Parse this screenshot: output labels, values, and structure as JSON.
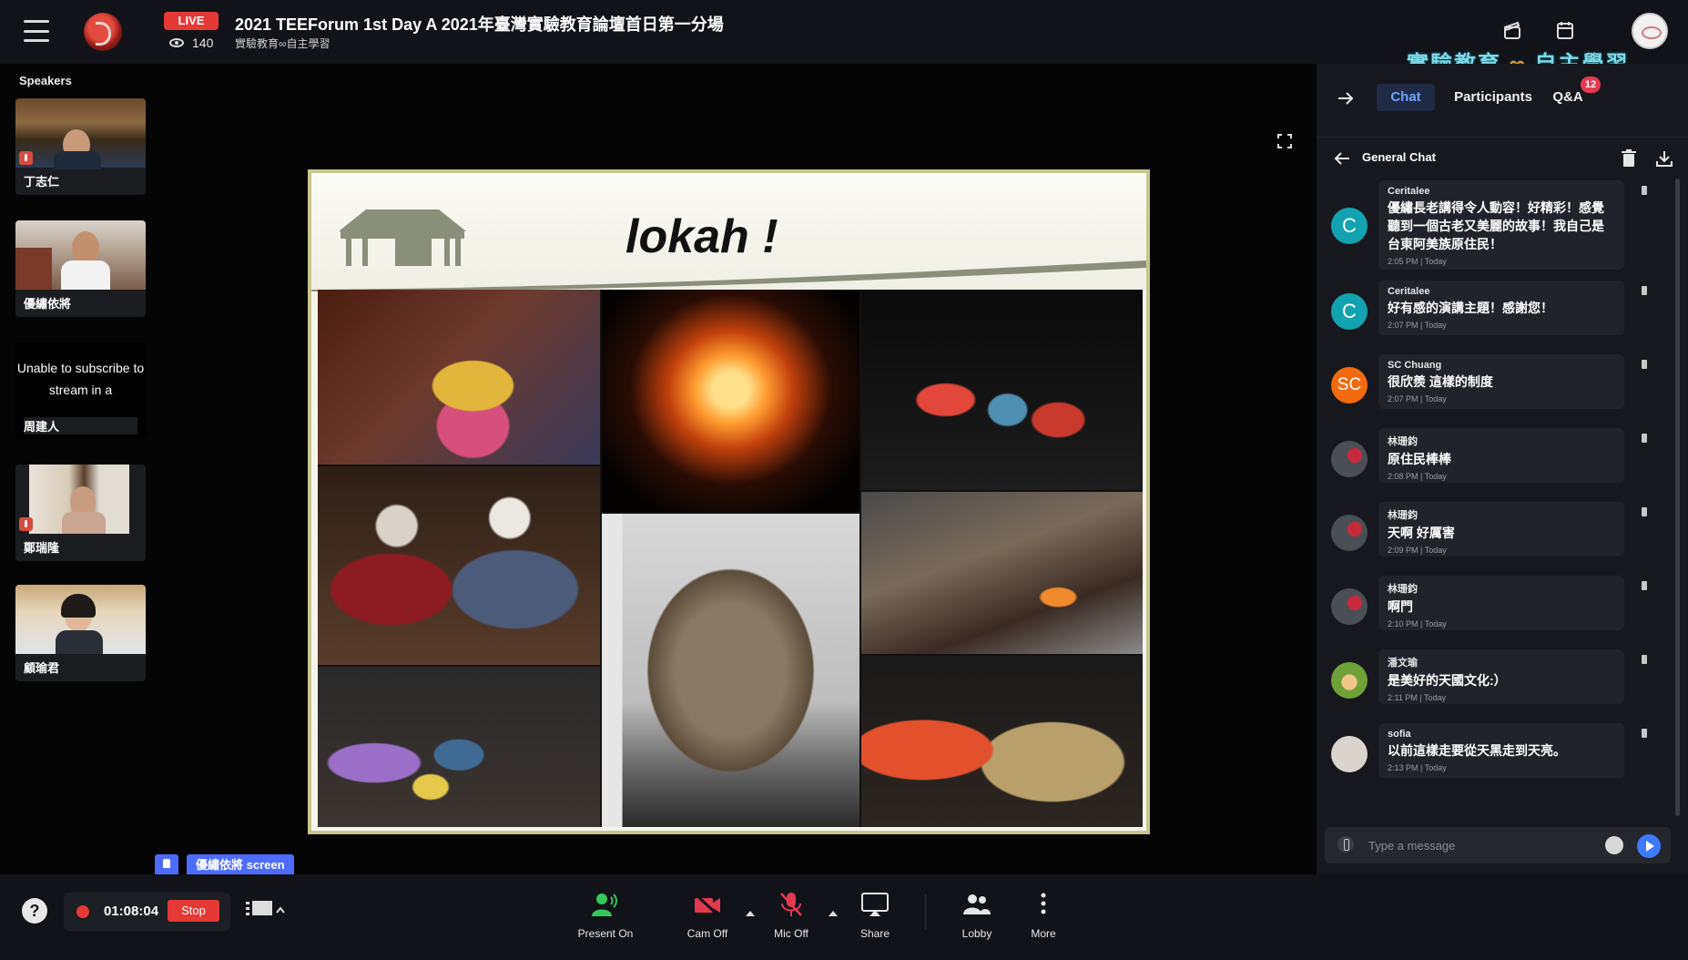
{
  "header": {
    "live_label": "LIVE",
    "viewer_count": "140",
    "title": "2021 TEEForum 1st Day A 2021年臺灣實驗教育論壇首日第一分場",
    "subtitle": "實驗教育∞自主學習",
    "watermark_left": "實驗教育",
    "watermark_infinity": "∞",
    "watermark_right": "自主學習"
  },
  "speakers": {
    "title": "Speakers",
    "tiles": [
      {
        "name": "丁志仁",
        "muted": true
      },
      {
        "name": "優繡依將",
        "muted": false
      },
      {
        "name": "周建人",
        "muted": false,
        "status": "Unable to subscribe to stream in a"
      },
      {
        "name": "鄭瑞隆",
        "muted": true
      },
      {
        "name": "顧瑜君",
        "muted": false
      }
    ]
  },
  "slide": {
    "title": "lokah !"
  },
  "chat": {
    "tabs": [
      "Chat",
      "Participants",
      "Q&A"
    ],
    "qa_badge": "12",
    "channel": "General Chat",
    "input_placeholder": "Type a message",
    "messages": [
      {
        "author": "Ceritalee",
        "initial": "C",
        "avatar_color": "#13a3b0",
        "text": "優繡長老講得令人動容！好精彩！感覺聽到一個古老又美麗的故事！我自己是台東阿美族原住民！",
        "time": "2:05 PM | Today"
      },
      {
        "author": "Ceritalee",
        "initial": "C",
        "avatar_color": "#13a3b0",
        "text": "好有感的演講主題！感謝您！",
        "time": "2:07 PM | Today"
      },
      {
        "author": "SC Chuang",
        "initial": "SC",
        "avatar_color": "#f26a0d",
        "text": "很欣羨 這樣的制度",
        "time": "2:07 PM | Today"
      },
      {
        "author": "林珊鈞",
        "initial": "",
        "avatar_color": "#4a4f55",
        "text": "原住民棒棒",
        "time": "2:08 PM | Today"
      },
      {
        "author": "林珊鈞",
        "initial": "",
        "avatar_color": "#4a4f55",
        "text": "天啊 好厲害",
        "time": "2:09 PM | Today"
      },
      {
        "author": "林珊鈞",
        "initial": "",
        "avatar_color": "#4a4f55",
        "text": "啊門",
        "time": "2:10 PM | Today"
      },
      {
        "author": "潘文瑜",
        "initial": "",
        "avatar_color": "#6ea238",
        "text": "是美好的天國文化:）",
        "time": "2:11 PM | Today"
      },
      {
        "author": "sofia",
        "initial": "",
        "avatar_color": "#d9d4cc",
        "text": "以前這樣走要從天黑走到天亮。",
        "time": "2:13 PM | Today"
      }
    ]
  },
  "screen_share": {
    "label": "優繡依將 screen"
  },
  "controls": {
    "recording_timer": "01:08:04",
    "stop_label": "Stop",
    "present_label": "Present On",
    "cam_label": "Cam Off",
    "mic_label": "Mic Off",
    "share_label": "Share",
    "lobby_label": "Lobby",
    "more_label": "More"
  }
}
